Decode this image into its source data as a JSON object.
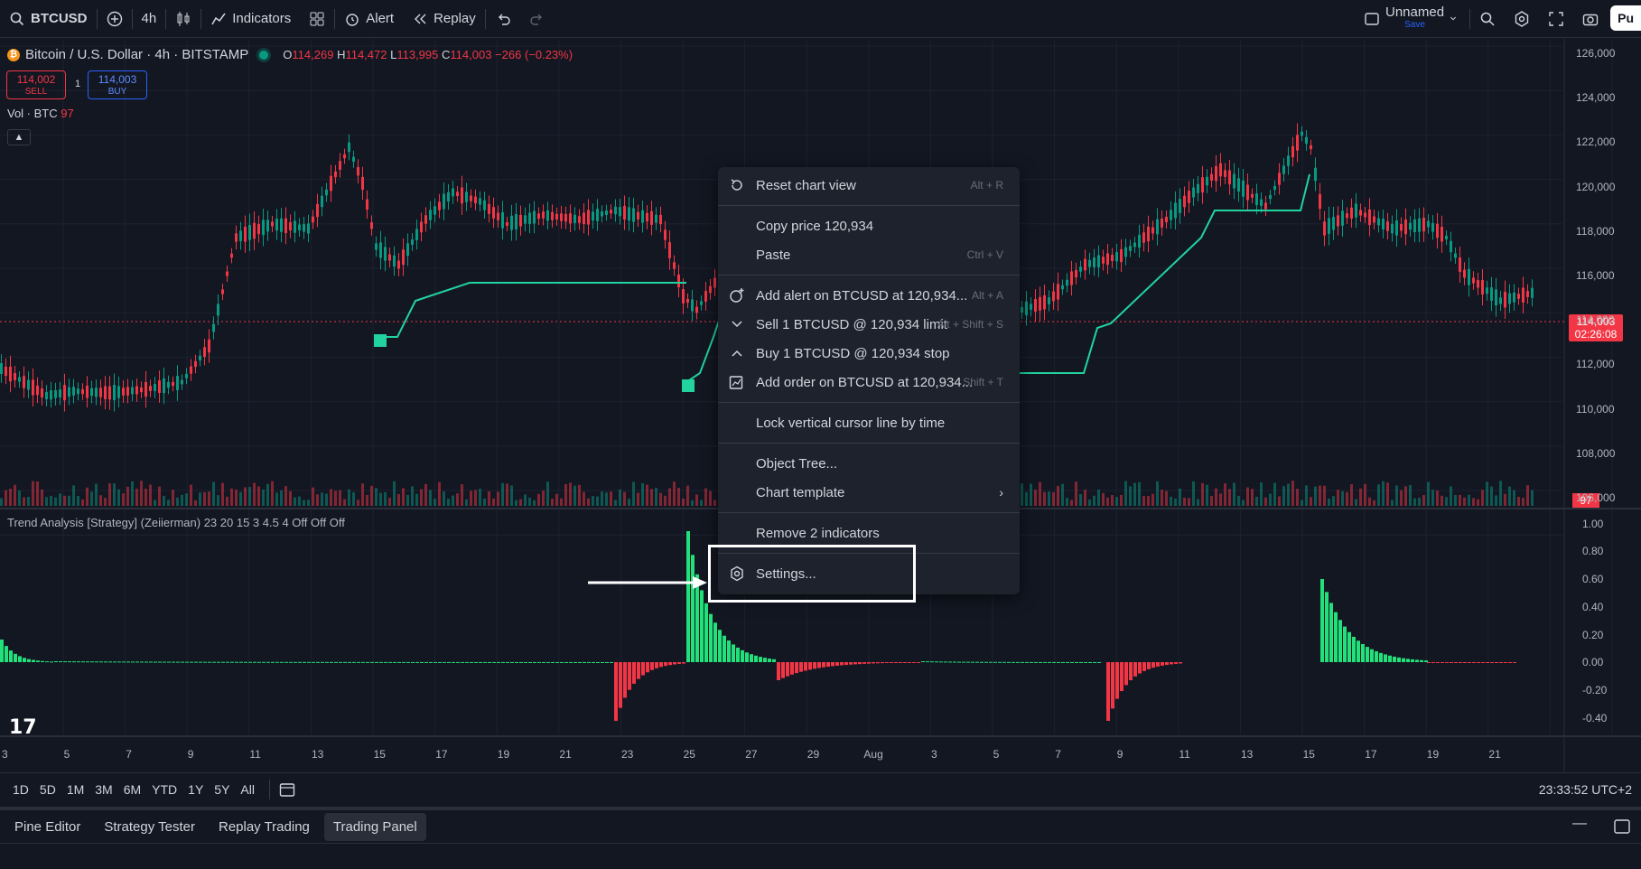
{
  "topbar": {
    "symbol": "BTCUSD",
    "interval": "4h",
    "indicators_label": "Indicators",
    "alert_label": "Alert",
    "replay_label": "Replay",
    "layout_name": "Unnamed",
    "save_label": "Save",
    "publish_label": "Pu"
  },
  "legend": {
    "title": "Bitcoin / U.S. Dollar · 4h · BITSTAMP",
    "o_key": "O",
    "o": "114,269",
    "h_key": "H",
    "h": "114,472",
    "l_key": "L",
    "l": "113,995",
    "c_key": "C",
    "c": "114,003",
    "change": "−266 (−0.23%)",
    "sell_price": "114,002",
    "sell_label": "SELL",
    "buy_price": "114,003",
    "buy_label": "BUY",
    "spread": "1",
    "vol_label": "Vol · BTC",
    "vol_value": "97",
    "indicator_label": "Trend Analysis [Strategy] (Zeiierman) 23 20 15 3 4.5 4  Off Off Off"
  },
  "price_axis": [
    "126,000",
    "124,000",
    "122,000",
    "120,000",
    "118,000",
    "116,000",
    "114,000",
    "112,000",
    "110,000",
    "108,000",
    "106,000"
  ],
  "indicator_axis": [
    "1.00",
    "0.80",
    "0.60",
    "0.40",
    "0.20",
    "0.00",
    "-0.20",
    "-0.40"
  ],
  "time_axis": [
    "3",
    "5",
    "7",
    "9",
    "11",
    "13",
    "15",
    "17",
    "19",
    "21",
    "23",
    "25",
    "27",
    "29",
    "Aug",
    "3",
    "5",
    "7",
    "9",
    "11",
    "13",
    "15",
    "17",
    "19",
    "21"
  ],
  "last_price_tag": {
    "price": "114,003",
    "countdown": "02:26:08"
  },
  "vol_tag": "97",
  "context_menu": {
    "reset": {
      "label": "Reset chart view",
      "shortcut": "Alt + R"
    },
    "copy_price": {
      "label": "Copy price 120,934"
    },
    "paste": {
      "label": "Paste",
      "shortcut": "Ctrl + V"
    },
    "add_alert": {
      "label": "Add alert on BTCUSD at 120,934...",
      "shortcut": "Alt + A"
    },
    "sell": {
      "label": "Sell 1 BTCUSD @ 120,934 limit",
      "shortcut": "Alt + Shift + S"
    },
    "buy": {
      "label": "Buy 1 BTCUSD @ 120,934 stop"
    },
    "add_order": {
      "label": "Add order on BTCUSD at 120,934...",
      "shortcut": "Shift + T"
    },
    "lock_cursor": {
      "label": "Lock vertical cursor line by time"
    },
    "object_tree": {
      "label": "Object Tree..."
    },
    "chart_template": {
      "label": "Chart template"
    },
    "remove_indicators": {
      "label": "Remove 2 indicators"
    },
    "settings": {
      "label": "Settings..."
    }
  },
  "ranges": [
    "1D",
    "5D",
    "1M",
    "3M",
    "6M",
    "YTD",
    "1Y",
    "5Y",
    "All"
  ],
  "clock": "23:33:52 UTC+2",
  "panel_tabs": [
    "Pine Editor",
    "Strategy Tester",
    "Replay Trading",
    "Trading Panel"
  ],
  "colors": {
    "up": "#089981",
    "down": "#f23645",
    "trend": "#22d3a0",
    "bg": "#131722"
  }
}
